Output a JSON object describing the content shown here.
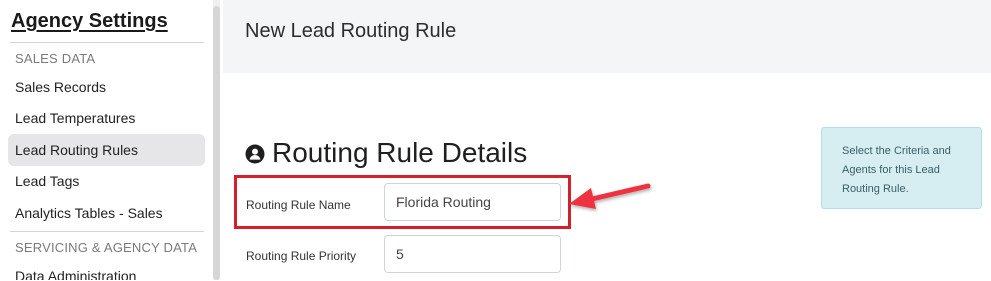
{
  "sidebar": {
    "title": "Agency Settings",
    "sections": [
      {
        "label": "SALES DATA"
      },
      {
        "label": "SERVICING & AGENCY DATA"
      }
    ],
    "items": [
      {
        "label": "Sales Records"
      },
      {
        "label": "Lead Temperatures"
      },
      {
        "label": "Lead Routing Rules"
      },
      {
        "label": "Lead Tags"
      },
      {
        "label": "Analytics Tables - Sales"
      },
      {
        "label": "Data Administration"
      }
    ],
    "active_item": "Lead Routing Rules"
  },
  "header": {
    "title": "New Lead Routing Rule"
  },
  "details": {
    "heading": "Routing Rule Details",
    "heading_icon": "user-circle-icon"
  },
  "info_box": {
    "text": "Select the Criteria and Agents for this Lead Routing Rule."
  },
  "form": {
    "name_label": "Routing Rule Name",
    "name_value": "Florida Routing",
    "priority_label": "Routing Rule Priority",
    "priority_value": "5"
  },
  "annotation": {
    "highlight_color": "#d4202a",
    "arrow_color": "#ee3340"
  }
}
